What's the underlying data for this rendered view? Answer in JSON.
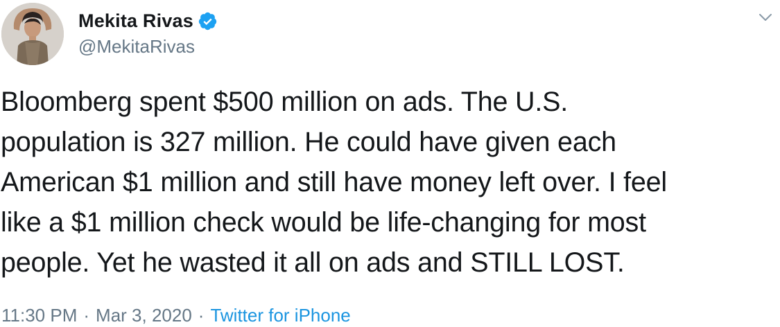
{
  "author": {
    "display_name": "Mekita Rivas",
    "handle": "@MekitaRivas",
    "verified": true
  },
  "tweet": {
    "text": "Bloomberg spent $500 million on ads. The U.S.\npopulation is 327 million. He could have given each\nAmerican $1 million and still have money left over. I feel\nlike a $1 million check would be life-changing for most\npeople. Yet he wasted it all on ads and STILL LOST.",
    "time": "11:30 PM",
    "date": "Mar 3, 2020",
    "separator": "·",
    "source": "Twitter for iPhone"
  },
  "icons": {
    "verified": "verified-badge-icon",
    "menu": "chevron-down-icon"
  },
  "colors": {
    "text": "#14171a",
    "secondary": "#657786",
    "link": "#1b95e0",
    "verified": "#1da1f2"
  }
}
